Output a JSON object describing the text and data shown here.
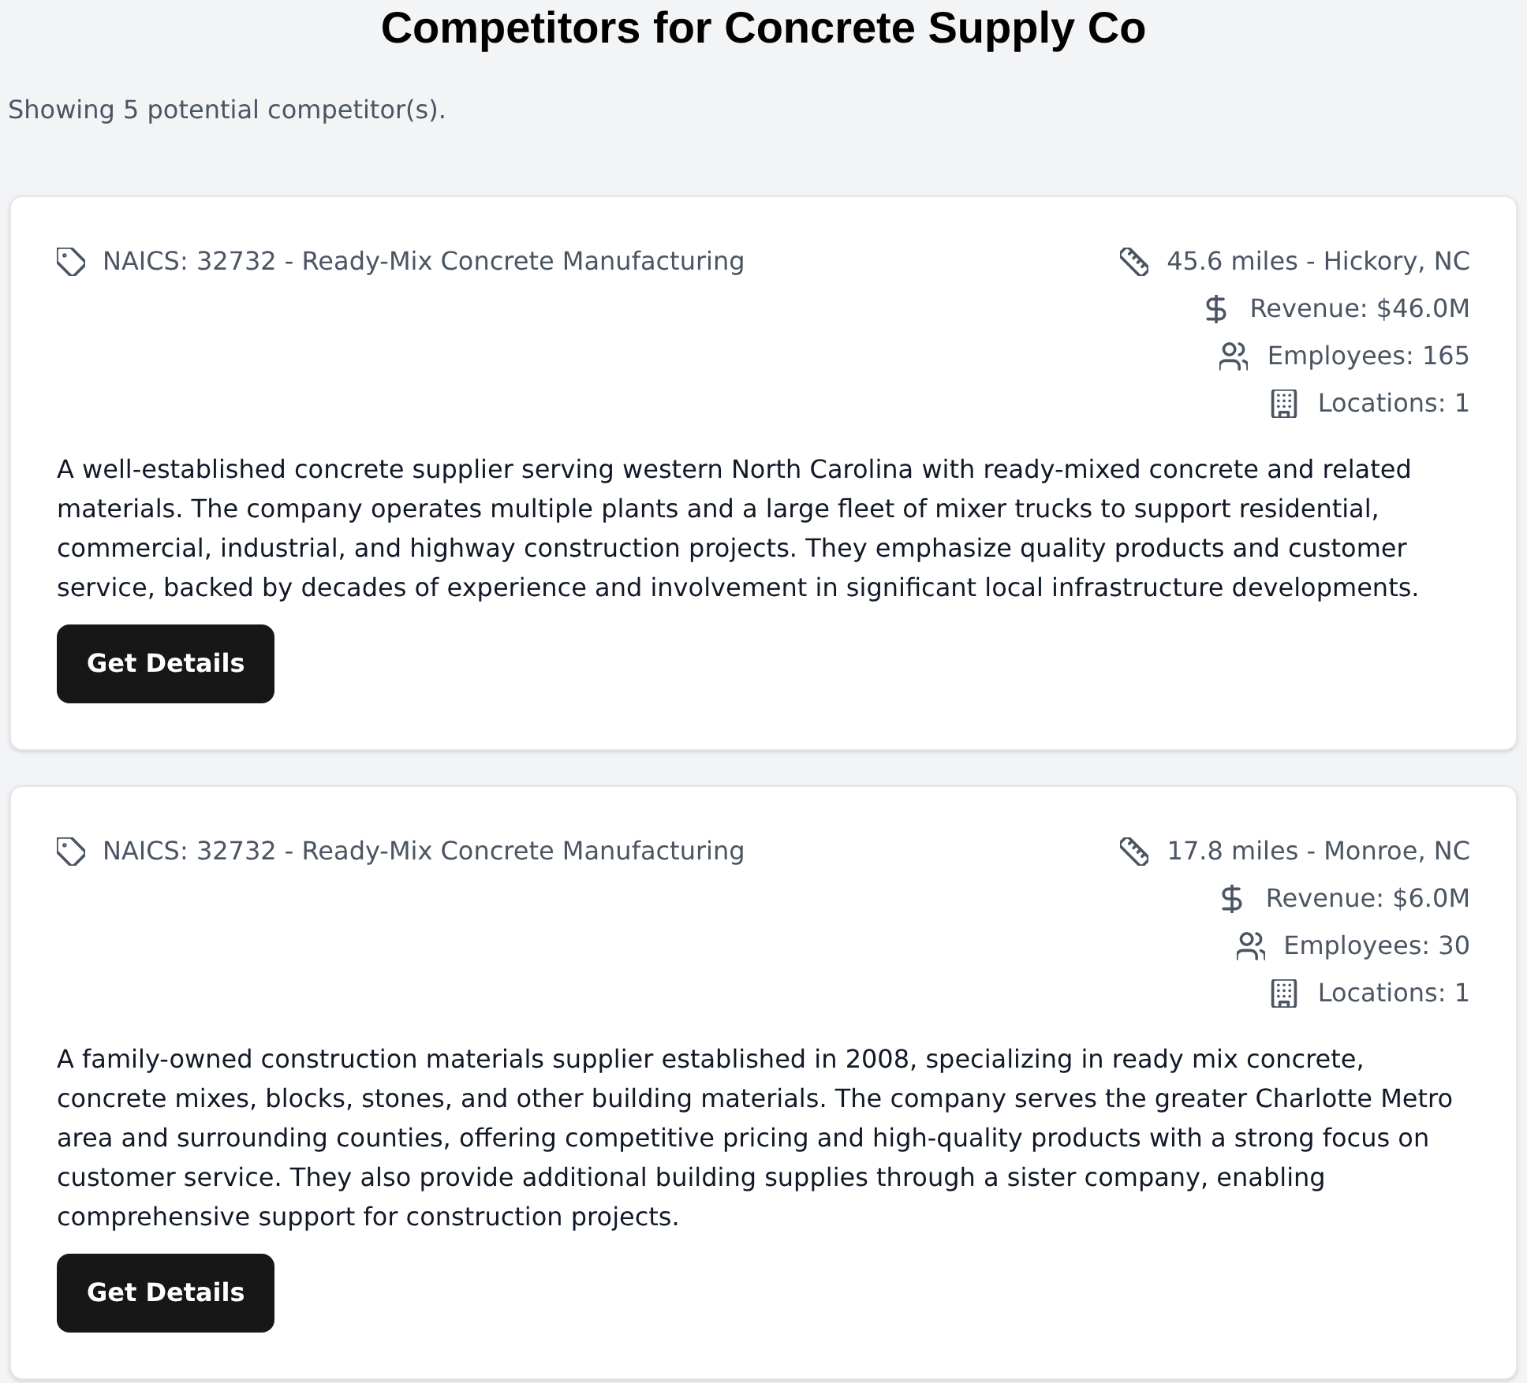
{
  "page": {
    "title": "Competitors for Concrete Supply Co",
    "summary": "Showing 5 potential competitor(s)."
  },
  "competitors": [
    {
      "naics": "NAICS: 32732 - Ready-Mix Concrete Manufacturing",
      "stats": [
        {
          "kind": "distance",
          "text": "45.6 miles - Hickory, NC"
        },
        {
          "kind": "revenue",
          "text": "Revenue: $46.0M"
        },
        {
          "kind": "employees",
          "text": "Employees: 165"
        },
        {
          "kind": "locations",
          "text": "Locations: 1"
        }
      ],
      "description": "A well-established concrete supplier serving western North Carolina with ready-mixed concrete and related materials. The company operates multiple plants and a large fleet of mixer trucks to support residential, commercial, industrial, and highway construction projects. They emphasize quality products and customer service, backed by decades of experience and involvement in significant local infrastructure developments.",
      "button": "Get Details"
    },
    {
      "naics": "NAICS: 32732 - Ready-Mix Concrete Manufacturing",
      "stats": [
        {
          "kind": "distance",
          "text": "17.8 miles - Monroe, NC"
        },
        {
          "kind": "revenue",
          "text": "Revenue: $6.0M"
        },
        {
          "kind": "employees",
          "text": "Employees: 30"
        },
        {
          "kind": "locations",
          "text": "Locations: 1"
        }
      ],
      "description": "A family-owned construction materials supplier established in 2008, specializing in ready mix concrete, concrete mixes, blocks, stones, and other building materials. The company serves the greater Charlotte Metro area and surrounding counties, offering competitive pricing and high-quality products with a strong focus on customer service. They also provide additional building supplies through a sister company, enabling comprehensive support for construction projects.",
      "button": "Get Details"
    }
  ]
}
